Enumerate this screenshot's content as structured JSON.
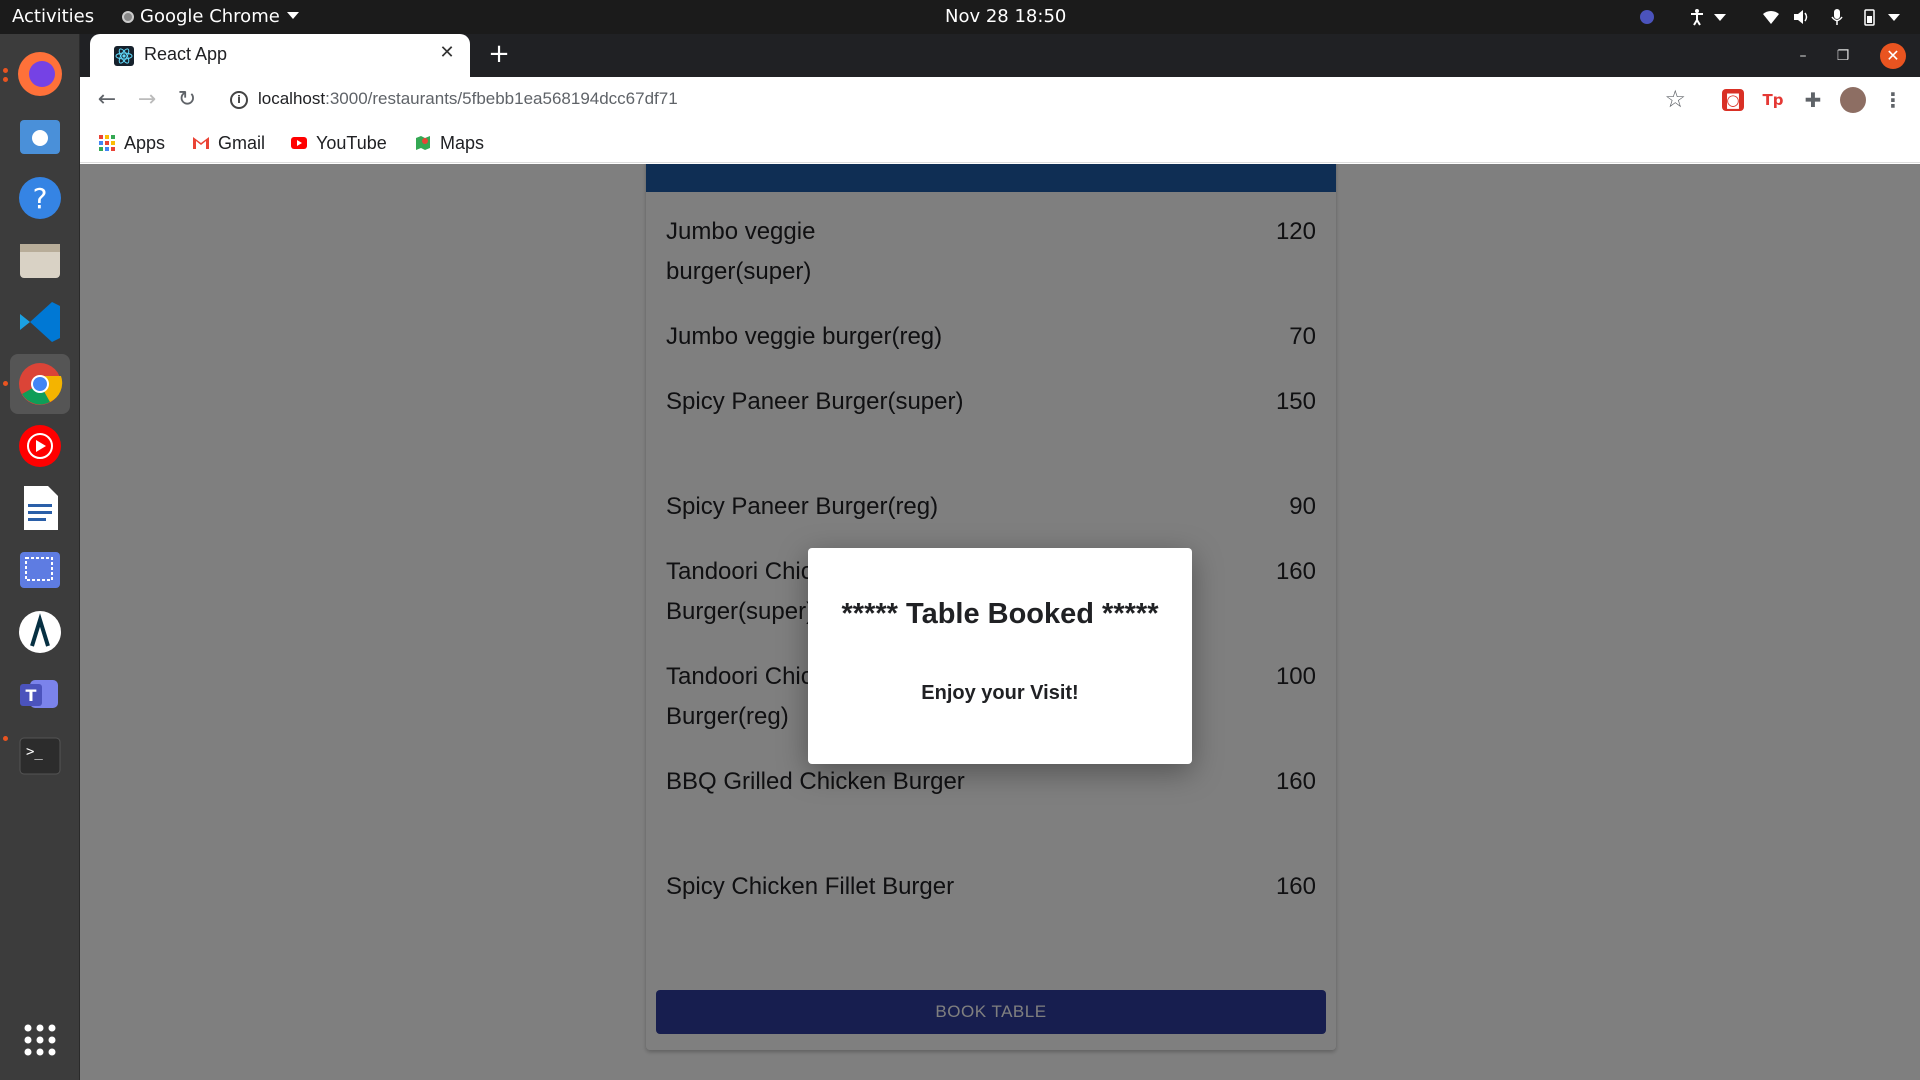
{
  "system": {
    "activities": "Activities",
    "app_menu": "Google Chrome",
    "clock": "Nov 28  18:50"
  },
  "browser": {
    "tab_title": "React App",
    "url_host": "localhost",
    "url_path": ":3000/restaurants/5fbebb1ea568194dcc67df71",
    "bookmarks": [
      {
        "label": "Apps",
        "icon": "apps-grid-icon"
      },
      {
        "label": "Gmail",
        "icon": "gmail-icon"
      },
      {
        "label": "YouTube",
        "icon": "youtube-icon"
      },
      {
        "label": "Maps",
        "icon": "maps-icon"
      }
    ]
  },
  "menu": {
    "items": [
      {
        "name": "Jumbo veggie burger(super)",
        "price": "120"
      },
      {
        "name": "Jumbo veggie burger(reg)",
        "price": "70"
      },
      {
        "name": "Spicy Paneer Burger(super)",
        "price": "150"
      },
      {
        "name": "Spicy Paneer Burger(reg)",
        "price": "90"
      },
      {
        "name": "Tandoori Chicken Burger(super)",
        "price": "160"
      },
      {
        "name": "Tandoori Chicken Burger(reg)",
        "price": "100"
      },
      {
        "name": "BBQ Grilled Chicken Burger",
        "price": "160"
      },
      {
        "name": "Spicy Chicken Fillet Burger",
        "price": "160"
      }
    ],
    "book_button": "BOOK TABLE"
  },
  "dialog": {
    "title": "***** Table Booked *****",
    "message": "Enjoy your Visit!"
  },
  "colors": {
    "header_blue": "#1f5ca8",
    "button_indigo": "#2f3c9e",
    "overlay": "rgba(0,0,0,0.5)"
  }
}
